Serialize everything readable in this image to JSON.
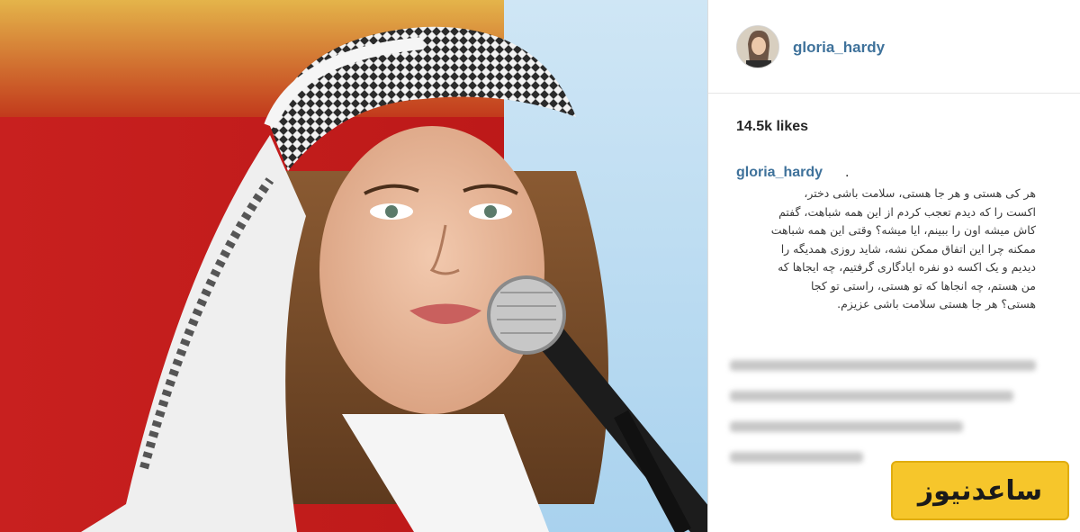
{
  "post": {
    "image_alt": "photo-woman-singing-microphone",
    "user": {
      "username": "gloria_hardy"
    },
    "likes": "14.5k likes",
    "caption": {
      "username": "gloria_hardy",
      "separator": ".",
      "lines": [
        "هر کی هستی و هر جا هستی، سلامت باشی دختر،",
        "اکست را که دیدم تعجب کردم از این همه شباهت، گفتم",
        "کاش میشه اون را ببینم، ایا میشه؟ وقتی این همه شباهت",
        "ممکنه چرا این اتفاق ممکن نشه، شاید روزی همدیگه را",
        "دیدیم و یک اکسه دو نفره ایادگاری گرفتیم، چه ایجاها که",
        "من هستم، چه انجاها که تو هستی، راستی تو کجا",
        "هستی؟ هر جا هستی سلامت باشی عزیزم."
      ]
    }
  },
  "watermark": {
    "text": "ساعدنیوز",
    "color": "#f6c62b"
  },
  "colors": {
    "username": "#3f729b",
    "text": "#262626"
  }
}
